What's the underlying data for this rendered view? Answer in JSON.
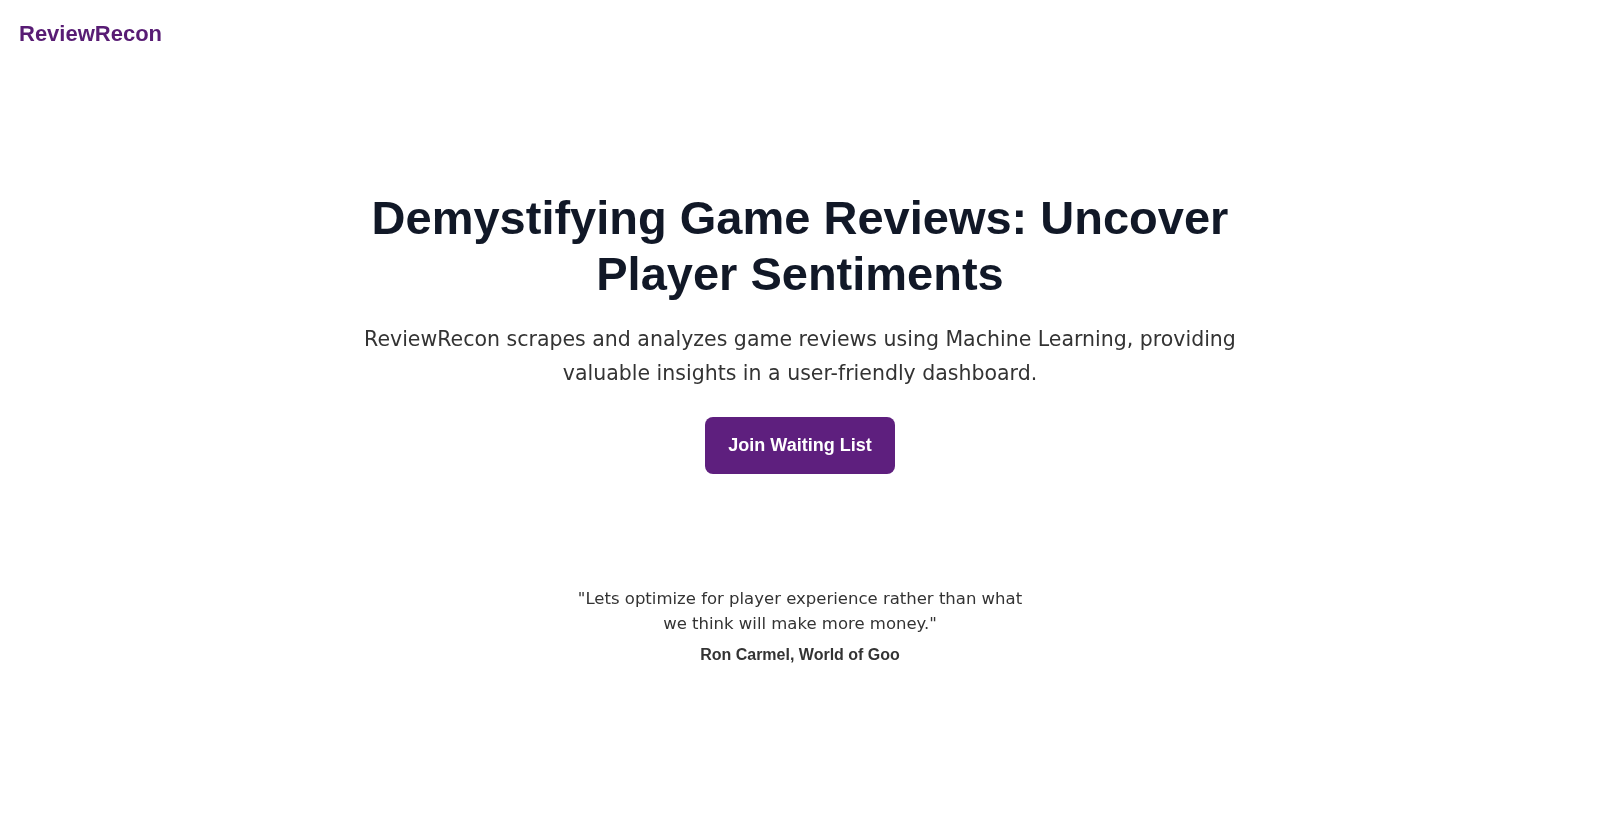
{
  "header": {
    "logo": "ReviewRecon"
  },
  "hero": {
    "title": "Demystifying Game Reviews: Uncover Player Sentiments",
    "description": "ReviewRecon scrapes and analyzes game reviews using Machine Learning, providing valuable insights in a user-friendly dashboard.",
    "button": "Join Waiting List"
  },
  "testimonial": {
    "quote": "\"Lets optimize for player experience rather than what we think will make more money.\"",
    "author": "Ron Carmel, World of Goo"
  }
}
